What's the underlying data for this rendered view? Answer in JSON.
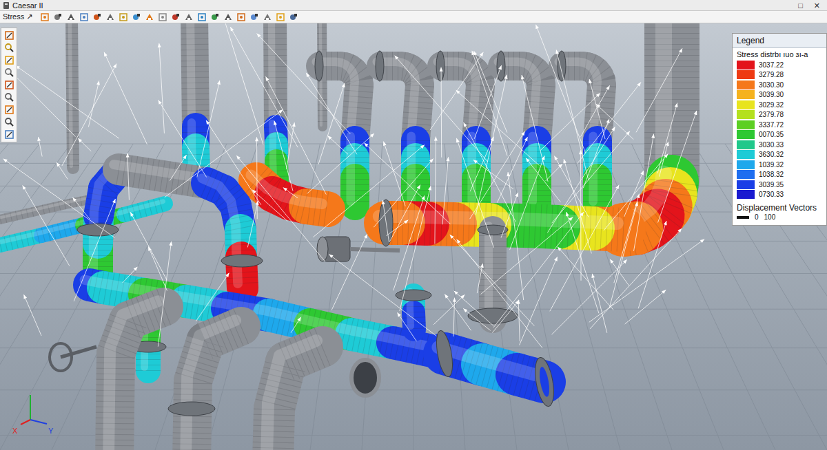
{
  "window": {
    "title": "Caesar II",
    "controls": [
      "□",
      "✕"
    ]
  },
  "toolbar": {
    "label": "Stress ↗"
  },
  "legend": {
    "title": "Legend",
    "subtitle": "Stress distrbı ıuo ɜı-a",
    "items": [
      {
        "value": "3037.22",
        "color": "#e3141b"
      },
      {
        "value": "3279.28",
        "color": "#ee3a12"
      },
      {
        "value": "3030.30",
        "color": "#f5781a"
      },
      {
        "value": "3039.30",
        "color": "#f5b21e"
      },
      {
        "value": "3029.32",
        "color": "#e8e41e"
      },
      {
        "value": "2379.78",
        "color": "#b4e01e"
      },
      {
        "value": "3337.72",
        "color": "#5ccf22"
      },
      {
        "value": "0070.35",
        "color": "#2ec832"
      },
      {
        "value": "3030.33",
        "color": "#20c88a"
      },
      {
        "value": "3630.32",
        "color": "#1ecbd6"
      },
      {
        "value": "1039.32",
        "color": "#1ea8ec"
      },
      {
        "value": "1038.32",
        "color": "#1e6ef0"
      },
      {
        "value": "3039.35",
        "color": "#1a3ee6"
      },
      {
        "value": "0730.33",
        "color": "#1a1ad0"
      }
    ],
    "vectors": {
      "title": "Displacement Vectors",
      "scale": [
        "0",
        "100"
      ]
    }
  },
  "axes": [
    {
      "label": "X",
      "color": "#e02020"
    },
    {
      "label": "Y",
      "color": "#2040e0"
    }
  ]
}
